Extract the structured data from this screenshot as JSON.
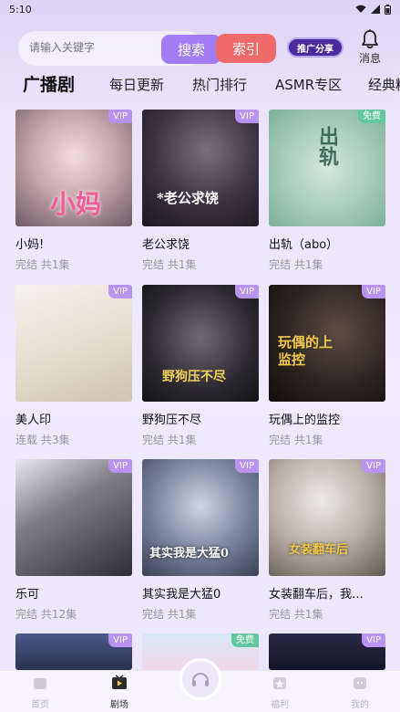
{
  "status": {
    "time": "5:10"
  },
  "header": {
    "search_placeholder": "请输入关键字",
    "search_label": "搜索",
    "index_label": "索引",
    "share_label": "推广分享",
    "message_label": "消息"
  },
  "tabs": [
    "广播剧",
    "每日更新",
    "热门排行",
    "ASMR专区",
    "经典精"
  ],
  "cards": [
    {
      "title": "小妈!",
      "meta": "完结 共1集",
      "badge": "VIP",
      "cover_text": "小妈"
    },
    {
      "title": "老公求饶",
      "meta": "完结 共1集",
      "badge": "VIP",
      "cover_text": "*老公求饶"
    },
    {
      "title": "出轨（abo）",
      "meta": "完结 共1集",
      "badge": "免费",
      "cover_text": "出轨"
    },
    {
      "title": "美人印",
      "meta": "连载 共3集",
      "badge": "VIP",
      "cover_text": ""
    },
    {
      "title": "野狗压不尽",
      "meta": "完结 共1集",
      "badge": "VIP",
      "cover_text": "野狗压不尽"
    },
    {
      "title": "玩偶上的监控",
      "meta": "完结 共1集",
      "badge": "VIP",
      "cover_text": "玩偶的上监控"
    },
    {
      "title": "乐可",
      "meta": "完结 共12集",
      "badge": "VIP",
      "cover_text": ""
    },
    {
      "title": "其实我是大猛0",
      "meta": "完结 共1集",
      "badge": "VIP",
      "cover_text": "其实我是大猛0"
    },
    {
      "title": "女装翻车后，我…",
      "meta": "完结 共1集",
      "badge": "VIP",
      "cover_text": "女装翻车后"
    },
    {
      "title": "",
      "meta": "",
      "badge": "VIP",
      "cover_text": ""
    },
    {
      "title": "",
      "meta": "",
      "badge": "免费",
      "cover_text": ""
    },
    {
      "title": "",
      "meta": "",
      "badge": "VIP",
      "cover_text": ""
    }
  ],
  "nav": {
    "home": "首页",
    "drama": "剧场",
    "welfare": "福利",
    "mine": "我的"
  }
}
